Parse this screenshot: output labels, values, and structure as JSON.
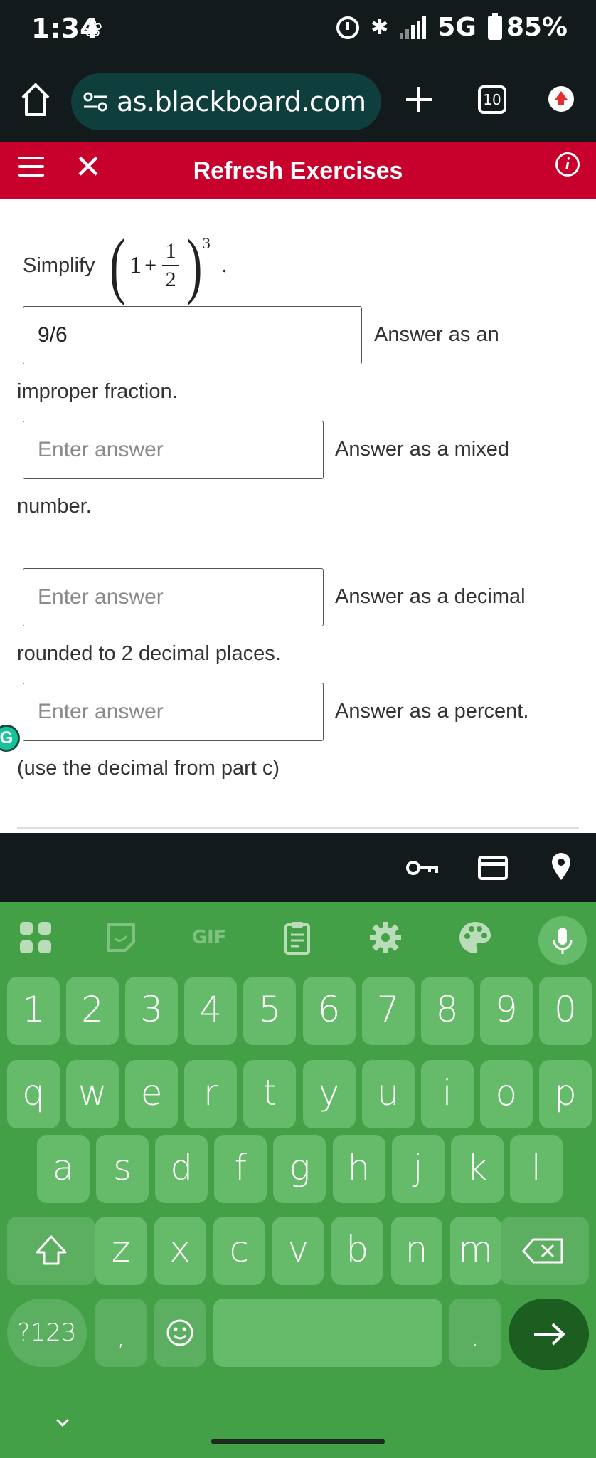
{
  "status_bar": {
    "time": "1:34",
    "network": "5G",
    "battery": "85%"
  },
  "browser": {
    "url": "as.blackboard.com",
    "tab_count": "10"
  },
  "app_header": {
    "title": "Refresh Exercises"
  },
  "question": {
    "prefix": "Simplify",
    "math_parts": {
      "open": "(",
      "one": "1",
      "plus": "+",
      "numerator": "1",
      "denominator": "2",
      "close": ")",
      "exponent": "3",
      "period": "."
    },
    "answers": [
      {
        "value": "9/6",
        "placeholder": "Enter answer",
        "hint": "Answer as an",
        "hint_cont": "improper fraction."
      },
      {
        "value": "",
        "placeholder": "Enter answer",
        "hint": "Answer as a mixed",
        "hint_cont": "number."
      },
      {
        "value": "",
        "placeholder": "Enter answer",
        "hint": "Answer as a decimal",
        "hint_cont": "rounded to 2 decimal places."
      },
      {
        "value": "",
        "placeholder": "Enter answer",
        "hint": "Answer as a percent.",
        "hint_cont": "(use the decimal from part c)"
      }
    ]
  },
  "keyboard": {
    "toolbar": [
      "apps-icon",
      "sticker-icon",
      "GIF",
      "clipboard-icon",
      "settings-icon",
      "palette-icon",
      "mic-icon"
    ],
    "gif_label": "GIF",
    "row_numbers": [
      "1",
      "2",
      "3",
      "4",
      "5",
      "6",
      "7",
      "8",
      "9",
      "0"
    ],
    "row1": [
      "q",
      "w",
      "e",
      "r",
      "t",
      "y",
      "u",
      "i",
      "o",
      "p"
    ],
    "row2": [
      "a",
      "s",
      "d",
      "f",
      "g",
      "h",
      "j",
      "k",
      "l"
    ],
    "row3": [
      "z",
      "x",
      "c",
      "v",
      "b",
      "n",
      "m"
    ],
    "symbols_label": "?123",
    "comma": ",",
    "period": "."
  },
  "colors": {
    "header_red": "#c8002c",
    "keyboard_green": "#43a047",
    "key_green": "#66bb6a",
    "dark_bar": "#121a1c",
    "url_pill": "#0f3f3c"
  }
}
